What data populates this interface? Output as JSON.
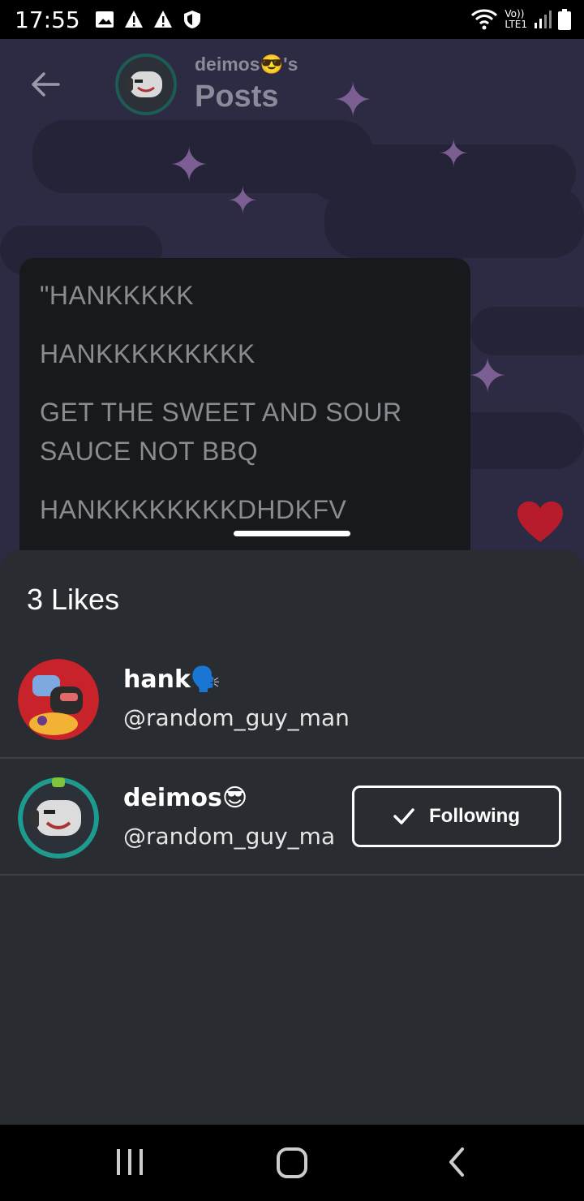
{
  "status_bar": {
    "time": "17:55",
    "left_icons": [
      "image-icon",
      "warning-icon",
      "warning-icon",
      "shield-icon"
    ],
    "right_icons": [
      "wifi-calling-icon",
      "volte-lte-icon",
      "signal-icon",
      "battery-icon"
    ],
    "network_label_top": "Vo))",
    "network_label_bottom": "LTE1"
  },
  "header": {
    "owner": "deimos😎's",
    "title": "Posts"
  },
  "post": {
    "lines": [
      "\"HANKKKKK",
      "HANKKKKKKKKK",
      "GET THE SWEET AND SOUR",
      "SAUCE NOT BBQ",
      "HANKKKKKKKKDHDKFV"
    ]
  },
  "likes_sheet": {
    "title": "3 Likes",
    "users": [
      {
        "name": "hank🗣️",
        "username": "@random_guy_man"
      },
      {
        "name": "deimos😎",
        "username": "@random_guy_ma",
        "button": "Following"
      }
    ]
  },
  "colors": {
    "sheet_bg": "#292c30",
    "background": "#2d2a44",
    "heart": "#b71c2c"
  }
}
